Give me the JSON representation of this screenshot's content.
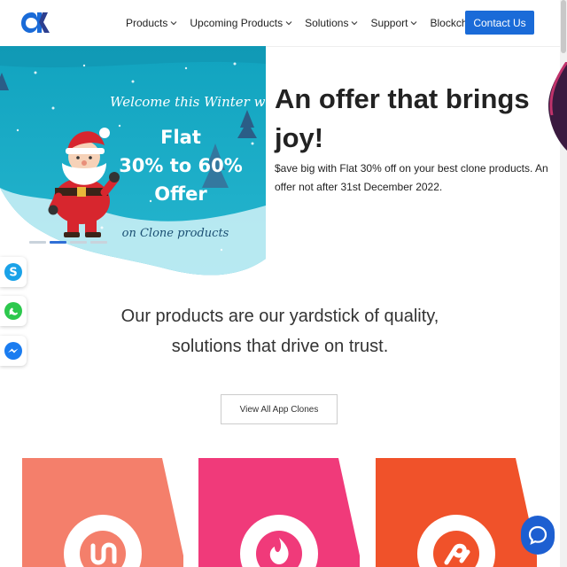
{
  "nav": {
    "items": [
      {
        "label": "Products"
      },
      {
        "label": "Upcoming Products"
      },
      {
        "label": "Solutions"
      },
      {
        "label": "Support"
      },
      {
        "label": "Blockchain"
      }
    ],
    "contact_label": "Contact Us"
  },
  "hero": {
    "banner": {
      "welcome": "Welcome this Winter with",
      "flat": "Flat",
      "range": "30% to 60%",
      "offer": "Offer",
      "subtitle": "on Clone products"
    },
    "title": "An offer that brings joy!",
    "text": "$ave big with Flat 30% off on your best clone products. An offer not after 31st December 2022.",
    "slide_count": 4,
    "active_slide": 2
  },
  "tagline": {
    "line1": "Our products are our yardstick of quality,",
    "line2": "solutions that drive on trust."
  },
  "view_all_label": "View All App Clones",
  "social": [
    "skype-icon",
    "whatsapp-icon",
    "messenger-icon"
  ],
  "cards": [
    {
      "color": "#f47f6b",
      "icon": "uber-like-icon"
    },
    {
      "color": "#f03a7a",
      "icon": "tinder-like-icon"
    },
    {
      "color": "#f0522a",
      "icon": "gojek-like-icon"
    }
  ],
  "colors": {
    "accent": "#1a6bd8",
    "banner": "#1aa6c2"
  }
}
